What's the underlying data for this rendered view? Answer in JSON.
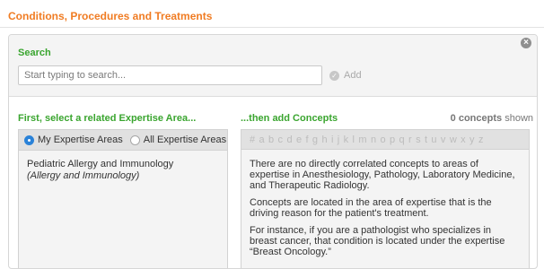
{
  "page": {
    "title": "Conditions, Procedures and Treatments"
  },
  "search": {
    "heading": "Search",
    "placeholder": "Start typing to search...",
    "add_label": "Add",
    "close_glyph": "×",
    "add_glyph": "✓"
  },
  "expertise": {
    "heading": "First, select a related Expertise Area...",
    "options": [
      {
        "label": "My Expertise Areas",
        "selected": true
      },
      {
        "label": "All Expertise Areas",
        "selected": false
      }
    ],
    "item_title": "Pediatric Allergy and Immunology",
    "item_subtitle": "(Allergy and Immunology)"
  },
  "concepts": {
    "heading": "...then add Concepts",
    "count": "0 concepts",
    "count_suffix": "shown",
    "alphabet": [
      "#",
      "a",
      "b",
      "c",
      "d",
      "e",
      "f",
      "g",
      "h",
      "i",
      "j",
      "k",
      "l",
      "m",
      "n",
      "o",
      "p",
      "q",
      "r",
      "s",
      "t",
      "u",
      "v",
      "w",
      "x",
      "y",
      "z"
    ],
    "paragraphs": [
      "There are no directly correlated concepts to areas of expertise in Anesthesiology, Pathology, Laboratory Medicine, and Therapeutic Radiology.",
      "Concepts are located in the area of expertise that is the driving reason for the patient's treatment.",
      "For instance, if you are a pathologist who specializes in breast cancer, that condition is located under the expertise “Breast Oncology.”"
    ]
  },
  "colors": {
    "title_orange": "#f07c23",
    "heading_green": "#3aa52f",
    "radio_blue": "#2a82d8"
  }
}
